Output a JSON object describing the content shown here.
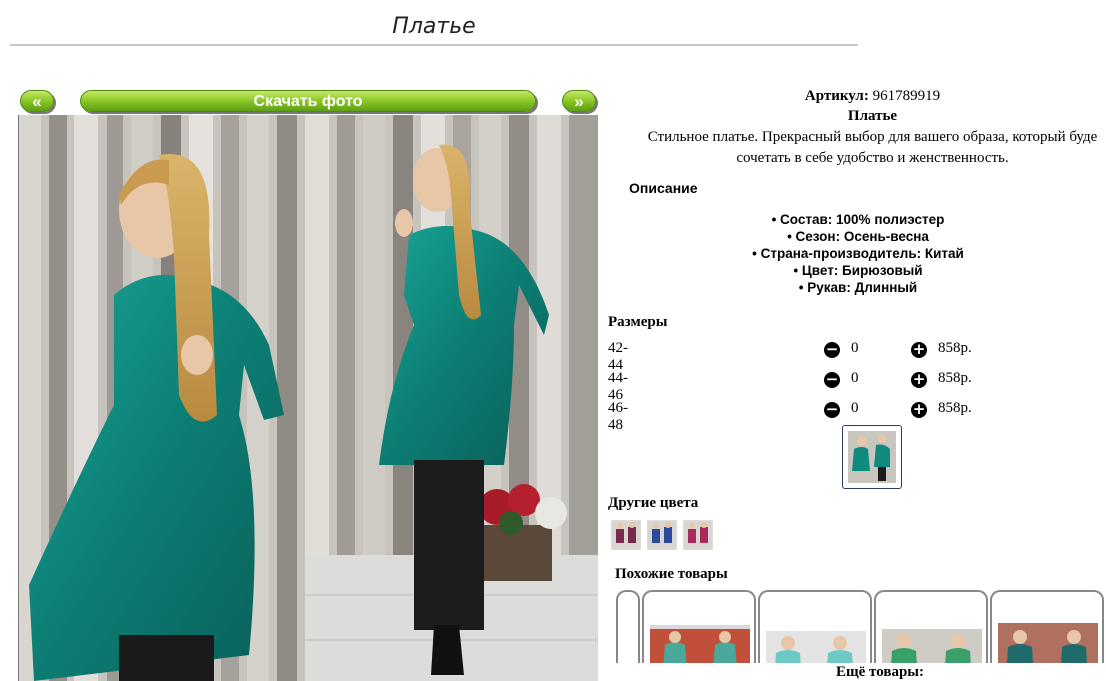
{
  "page": {
    "title": "Платье"
  },
  "gallery": {
    "prev_label": "«",
    "download_label": "Скачать фото",
    "next_label": "»"
  },
  "product": {
    "sku_label": "Артикул:",
    "sku": "961789919",
    "name": "Платье",
    "description_line1": "Стильное платье. Прекрасный выбор для вашего образа, который буде",
    "description_line2": "сочетать в себе удобство и женственность.",
    "description_heading": "Описание",
    "properties": [
      "Состав: 100% полиэстер",
      "Сезон: Осень-весна",
      "Страна-производитель: Китай",
      "Цвет: Бирюзовый",
      "Рукав: Длинный"
    ]
  },
  "sizes": {
    "heading": "Размеры",
    "rows": [
      {
        "size": "42-44",
        "qty": "0",
        "price": "858р."
      },
      {
        "size": "44-46",
        "qty": "0",
        "price": "858р."
      },
      {
        "size": "46-48",
        "qty": "0",
        "price": "858р."
      }
    ]
  },
  "other_colors": {
    "heading": "Другие цвета",
    "swatches": [
      "#7a2a4a",
      "#2a4a9a",
      "#a82a5a"
    ]
  },
  "similar": {
    "heading": "Похожие товары",
    "more_label": "Ещё товары:"
  },
  "colors": {
    "accent_green": "#7fbf25",
    "dress_teal": "#0f8a7e",
    "icon_black": "#000000"
  },
  "icons": {
    "minus": "minus-circle-icon",
    "plus": "plus-circle-icon"
  }
}
